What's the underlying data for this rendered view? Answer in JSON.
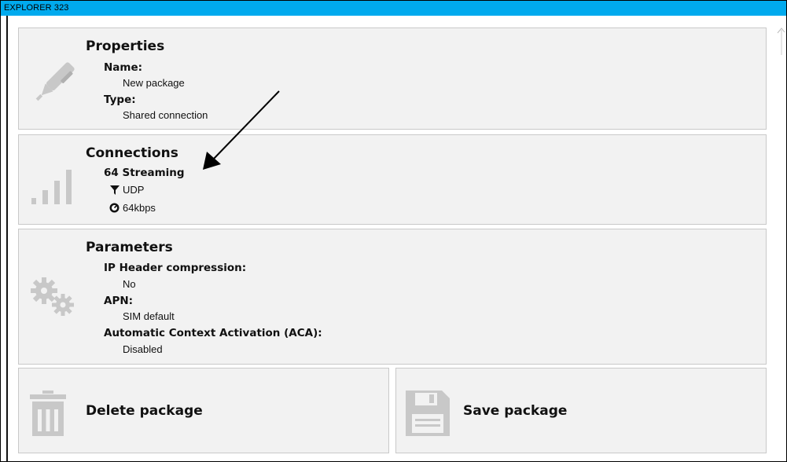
{
  "window": {
    "title": "EXPLORER 323"
  },
  "properties": {
    "title": "Properties",
    "name_label": "Name:",
    "name_value": "New package",
    "type_label": "Type:",
    "type_value": "Shared connection"
  },
  "connections": {
    "title": "Connections",
    "item_title": "64 Streaming",
    "protocol": "UDP",
    "speed": "64kbps"
  },
  "parameters": {
    "title": "Parameters",
    "items": [
      {
        "label": "IP Header compression:",
        "value": "No"
      },
      {
        "label": "APN:",
        "value": "SIM default"
      },
      {
        "label": "Automatic Context Activation (ACA):",
        "value": "Disabled"
      }
    ]
  },
  "actions": {
    "delete_label": "Delete package",
    "save_label": "Save package"
  },
  "colors": {
    "titlebar": "#00aaee",
    "panel_bg": "#f2f2f2",
    "icon_gray": "#c8c8c8"
  }
}
